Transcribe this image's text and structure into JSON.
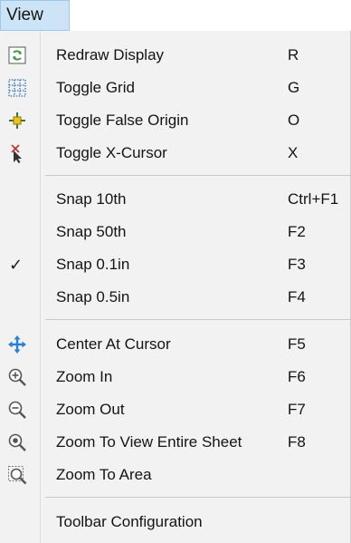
{
  "menubar": {
    "title": "View"
  },
  "menu": {
    "items": [
      {
        "label": "Redraw Display",
        "shortcut": "R",
        "icon": "redraw-icon"
      },
      {
        "label": "Toggle Grid",
        "shortcut": "G",
        "icon": "grid-icon"
      },
      {
        "label": "Toggle False Origin",
        "shortcut": "O",
        "icon": "false-origin-icon"
      },
      {
        "label": "Toggle X-Cursor",
        "shortcut": "X",
        "icon": "x-cursor-icon"
      },
      {
        "label": "Snap 10th",
        "shortcut": "Ctrl+F1"
      },
      {
        "label": "Snap 50th",
        "shortcut": "F2"
      },
      {
        "label": "Snap 0.1in",
        "shortcut": "F3",
        "checked": true,
        "check_glyph": "✓"
      },
      {
        "label": "Snap 0.5in",
        "shortcut": "F4"
      },
      {
        "label": "Center At Cursor",
        "shortcut": "F5",
        "icon": "center-cursor-icon"
      },
      {
        "label": "Zoom In",
        "shortcut": "F6",
        "icon": "zoom-in-icon"
      },
      {
        "label": "Zoom Out",
        "shortcut": "F7",
        "icon": "zoom-out-icon"
      },
      {
        "label": "Zoom To View Entire Sheet",
        "shortcut": "F8",
        "icon": "zoom-sheet-icon"
      },
      {
        "label": "Zoom To Area",
        "shortcut": "",
        "icon": "zoom-area-icon"
      },
      {
        "label": "Toolbar Configuration",
        "shortcut": ""
      }
    ]
  },
  "colors": {
    "menubar_highlight": "#cde4f7",
    "menu_background": "#f2f2f2",
    "icon_blue": "#2a7fd4",
    "icon_green": "#3d9a3d"
  }
}
